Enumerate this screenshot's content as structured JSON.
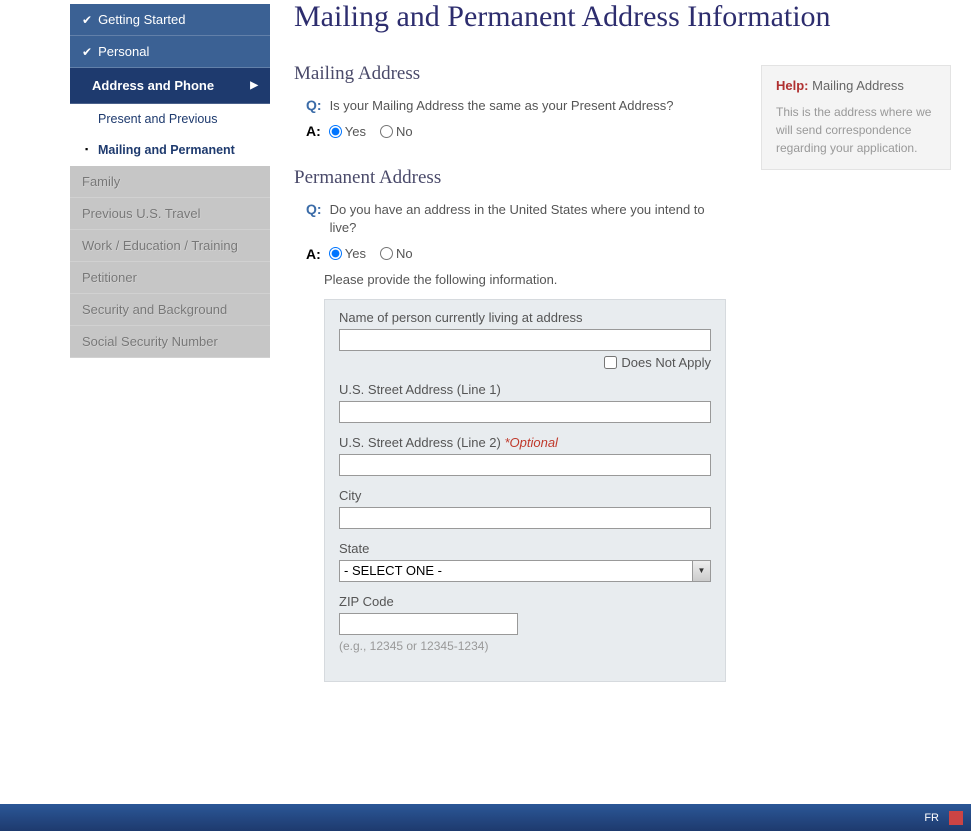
{
  "pageTitle": "Mailing and Permanent Address Information",
  "sidebar": {
    "completed": [
      {
        "label": "Getting Started"
      },
      {
        "label": "Personal"
      }
    ],
    "current": {
      "label": "Address and Phone"
    },
    "subItems": [
      {
        "label": "Present and Previous",
        "active": false
      },
      {
        "label": "Mailing and Permanent",
        "active": true
      }
    ],
    "disabled": [
      {
        "label": "Family"
      },
      {
        "label": "Previous U.S. Travel"
      },
      {
        "label": "Work / Education / Training"
      },
      {
        "label": "Petitioner"
      },
      {
        "label": "Security and Background"
      },
      {
        "label": "Social Security Number"
      }
    ]
  },
  "mailing": {
    "sectionTitle": "Mailing Address",
    "qPrefix": "Q:",
    "question": "Is your Mailing Address the same as your Present Address?",
    "aPrefix": "A:",
    "yes": "Yes",
    "no": "No"
  },
  "permanent": {
    "sectionTitle": "Permanent Address",
    "qPrefix": "Q:",
    "question": "Do you have an address in the United States where you intend to live?",
    "aPrefix": "A:",
    "yes": "Yes",
    "no": "No",
    "infoText": "Please provide the following information.",
    "fields": {
      "nameLabel": "Name of person currently living at address",
      "dnaLabel": "Does Not Apply",
      "line1Label": "U.S. Street Address (Line 1)",
      "line2Label": "U.S. Street Address (Line 2) ",
      "line2Optional": "*Optional",
      "cityLabel": "City",
      "stateLabel": "State",
      "stateSelected": "- SELECT ONE -",
      "zipLabel": "ZIP Code",
      "zipHint": "(e.g., 12345 or 12345-1234)"
    }
  },
  "help": {
    "helpLabel": "Help:",
    "topic": "Mailing Address",
    "text": "This is the address where we will send correspondence regarding your application."
  },
  "taskbar": {
    "lang": "FR"
  }
}
